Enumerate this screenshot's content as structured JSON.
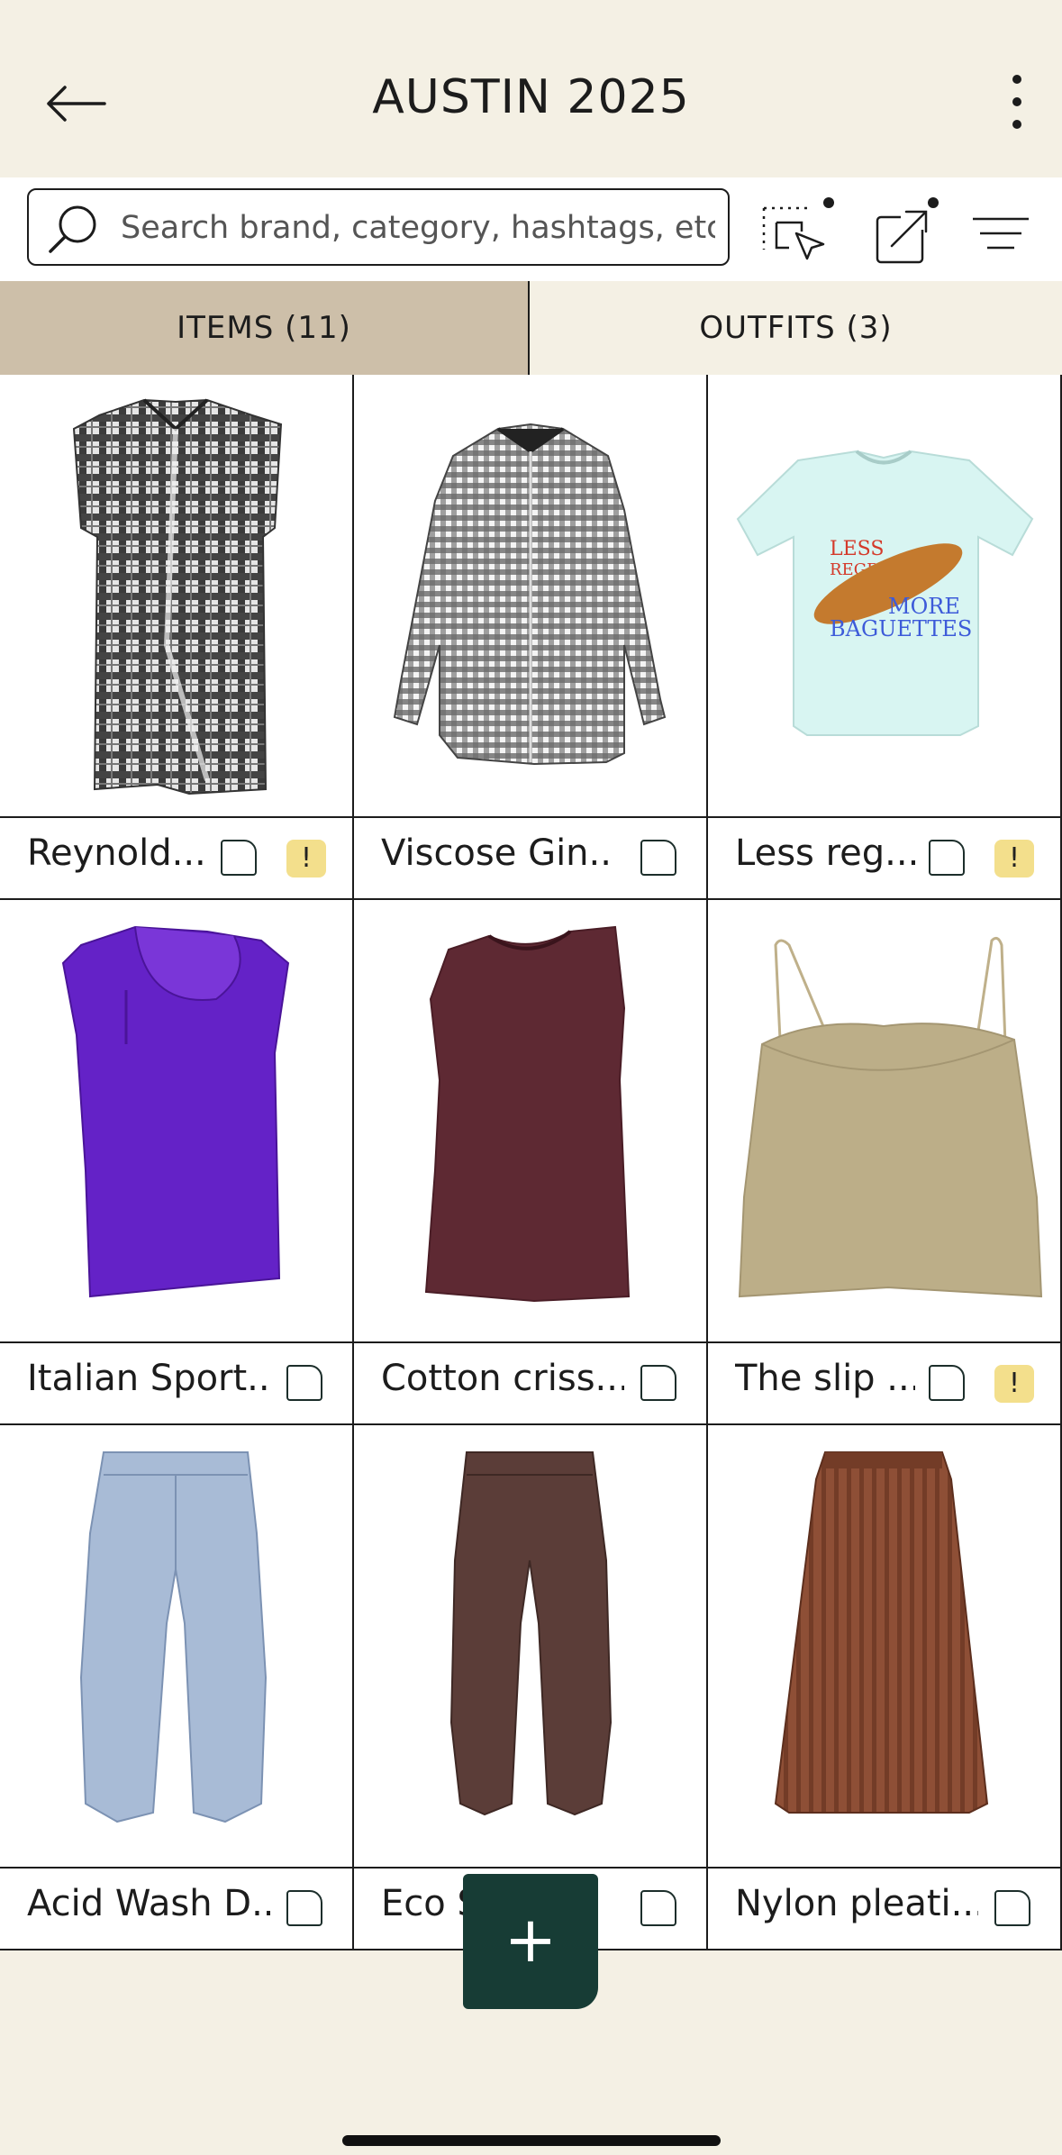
{
  "header": {
    "title": "AUSTIN 2025"
  },
  "search": {
    "placeholder": "Search brand, category, hashtags, etc."
  },
  "tabs": [
    {
      "label": "ITEMS (11)",
      "active": true
    },
    {
      "label": "OUTFITS (3)",
      "active": false
    }
  ],
  "items": [
    {
      "label": "Reynold...",
      "warning": "!"
    },
    {
      "label": "Viscose Gin...",
      "warning": ""
    },
    {
      "label": "Less reg...",
      "warning": "!"
    },
    {
      "label": "Italian Sport...",
      "warning": ""
    },
    {
      "label": "Cotton criss...",
      "warning": ""
    },
    {
      "label": "The slip ...",
      "warning": "!"
    },
    {
      "label": "Acid Wash D...",
      "warning": ""
    },
    {
      "label": "Eco S",
      "warning": ""
    },
    {
      "label": "Nylon pleati...",
      "warning": ""
    }
  ],
  "tshirt_print": {
    "line1": "LESS",
    "line2": "REGRETS",
    "line3": "MORE",
    "line4": "BAGUETTES"
  },
  "fab": {
    "label": "+"
  },
  "colors": {
    "background": "#f4f0e4",
    "active_tab": "#cdbfa9",
    "fab": "#173c35",
    "warning": "#f3df8c"
  }
}
